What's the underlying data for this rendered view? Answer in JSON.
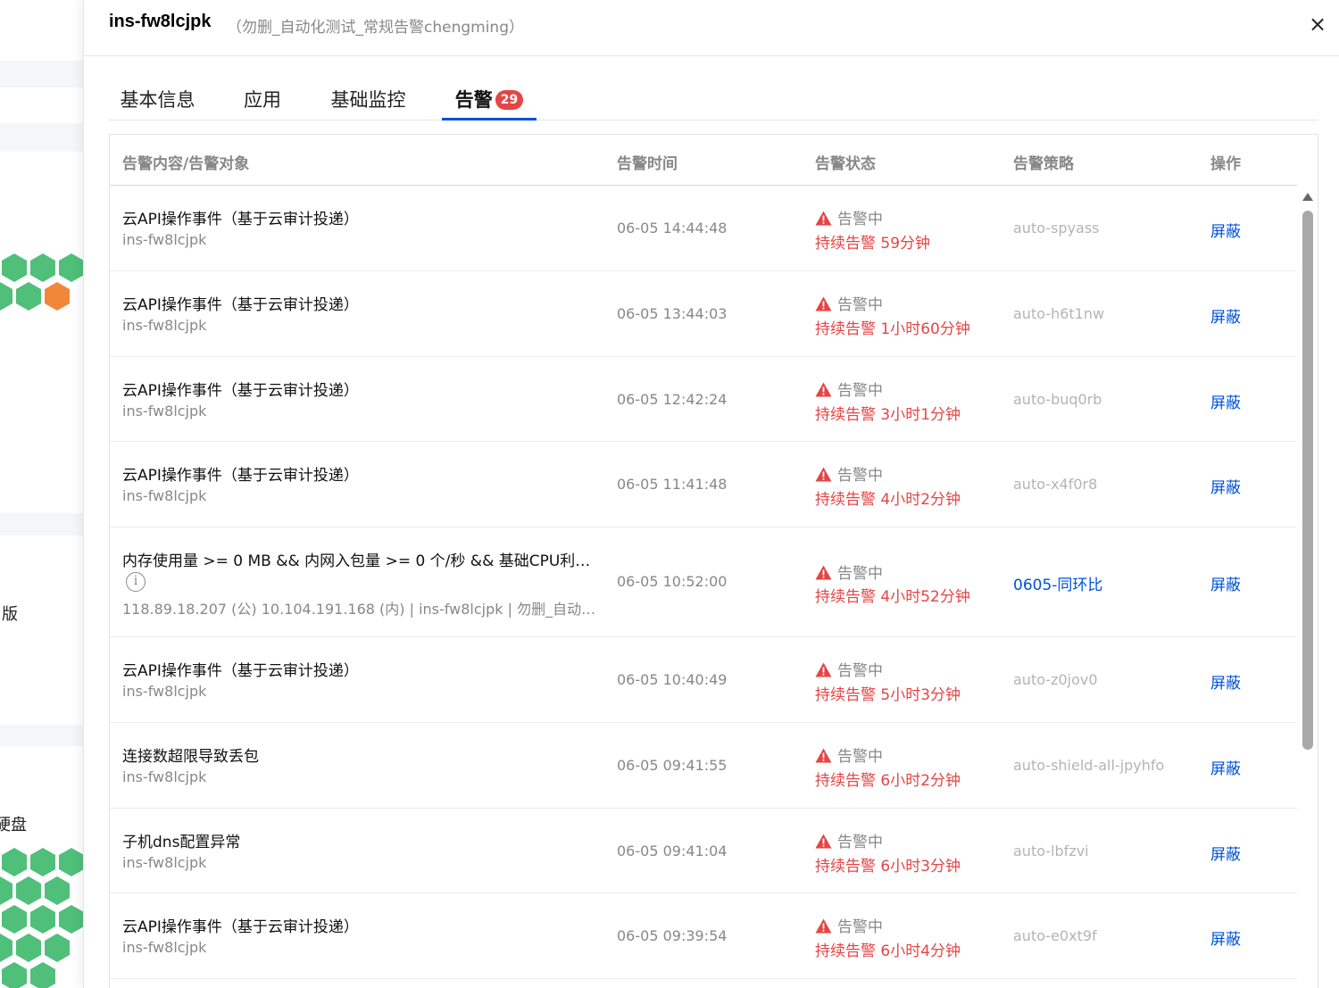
{
  "background": {
    "text_ban": "版",
    "text_disk": "硬盘"
  },
  "drawer": {
    "title": "ins-fw8lcjpk",
    "subtitle": "（勿删_自动化测试_常规告警chengming）",
    "close_label": "×"
  },
  "tabs": [
    {
      "label": "基本信息",
      "active": false
    },
    {
      "label": "应用",
      "active": false
    },
    {
      "label": "基础监控",
      "active": false
    },
    {
      "label": "告警",
      "active": true,
      "badge": "29"
    }
  ],
  "table": {
    "headers": [
      "告警内容/告警对象",
      "告警时间",
      "告警状态",
      "告警策略",
      "操作"
    ],
    "rows": [
      {
        "title": "云API操作事件（基于云审计投递）",
        "object": "ins-fw8lcjpk",
        "time": "06-05 14:44:48",
        "status": "告警中",
        "duration": "持续告警 59分钟",
        "policy": "auto-spyass",
        "action": "屏蔽"
      },
      {
        "title": "云API操作事件（基于云审计投递）",
        "object": "ins-fw8lcjpk",
        "time": "06-05 13:44:03",
        "status": "告警中",
        "duration": "持续告警 1小时60分钟",
        "policy": "auto-h6t1nw",
        "action": "屏蔽"
      },
      {
        "title": "云API操作事件（基于云审计投递）",
        "object": "ins-fw8lcjpk",
        "time": "06-05 12:42:24",
        "status": "告警中",
        "duration": "持续告警 3小时1分钟",
        "policy": "auto-buq0rb",
        "action": "屏蔽"
      },
      {
        "title": "云API操作事件（基于云审计投递）",
        "object": "ins-fw8lcjpk",
        "time": "06-05 11:41:48",
        "status": "告警中",
        "duration": "持续告警 4小时2分钟",
        "policy": "auto-x4f0r8",
        "action": "屏蔽"
      },
      {
        "title": "内存使用量 >= 0 MB && 内网入包量 >= 0 个/秒 && 基础CPU利…",
        "info_icon": "i",
        "object": "118.89.18.207 (公) 10.104.191.168 (内) | ins-fw8lcjpk | 勿删_自动…",
        "time": "06-05 10:52:00",
        "status": "告警中",
        "duration": "持续告警 4小时52分钟",
        "policy": "0605-同环比",
        "action": "屏蔽"
      },
      {
        "title": "云API操作事件（基于云审计投递）",
        "object": "ins-fw8lcjpk",
        "time": "06-05 10:40:49",
        "status": "告警中",
        "duration": "持续告警 5小时3分钟",
        "policy": "auto-z0jov0",
        "action": "屏蔽"
      },
      {
        "title": "连接数超限导致丢包",
        "object": "ins-fw8lcjpk",
        "time": "06-05 09:41:55",
        "status": "告警中",
        "duration": "持续告警 6小时2分钟",
        "policy": "auto-shield-all-jpyhfo",
        "action": "屏蔽"
      },
      {
        "title": "子机dns配置异常",
        "object": "ins-fw8lcjpk",
        "time": "06-05 09:41:04",
        "status": "告警中",
        "duration": "持续告警 6小时3分钟",
        "policy": "auto-lbfzvi",
        "action": "屏蔽"
      },
      {
        "title": "云API操作事件（基于云审计投递）",
        "object": "ins-fw8lcjpk",
        "time": "06-05 09:39:54",
        "status": "告警中",
        "duration": "持续告警 6小时4分钟",
        "policy": "auto-e0xt9f",
        "action": "屏蔽"
      }
    ]
  },
  "colors": {
    "accent": "#0052d9",
    "alert_red": "#e54545",
    "hex_green": "#4fbf7a",
    "hex_orange": "#f0883a"
  }
}
